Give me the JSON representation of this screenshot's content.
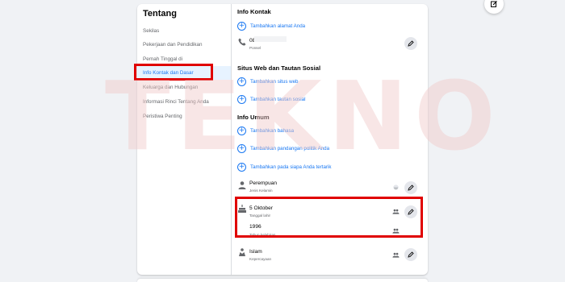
{
  "watermark": "TEKNO",
  "sidebar": {
    "title": "Tentang",
    "items": [
      {
        "label": "Sekilas"
      },
      {
        "label": "Pekerjaan dan Pendidikan"
      },
      {
        "label": "Pernah Tinggal di"
      },
      {
        "label": "Info Kontak dan Dasar",
        "active": true
      },
      {
        "label": "Keluarga dan Hubungan"
      },
      {
        "label": "Informasi Rinci Tentang Anda"
      },
      {
        "label": "Peristiwa Penting"
      }
    ]
  },
  "contact": {
    "title": "Info Kontak",
    "add_address": "Tambahkan alamat Anda",
    "phone_value": "081",
    "phone_sub": "Ponsel"
  },
  "web": {
    "title": "Situs Web dan Tautan Sosial",
    "add_site": "Tambahkan situs web",
    "add_link": "Tambahkan tautan sosial"
  },
  "general": {
    "title": "Info Umum",
    "add_language": "Tambahkan bahasa",
    "add_politics": "Tambahkan pandangan politik Anda",
    "add_interest": "Tambahkan pada siapa Anda tertarik",
    "gender_value": "Perempuan",
    "gender_sub": "Jenis Kelamin",
    "birthdate_value": "5 Oktober",
    "birthdate_sub": "Tanggal lahir",
    "birthyear_value": "1996",
    "birthyear_sub": "Tahun kelahiran",
    "religion_value": "Islam",
    "religion_sub": "Kepercayaan"
  },
  "icons": {
    "plus": "plus-circle-icon",
    "edit": "pencil-icon",
    "phone": "phone-icon",
    "person": "person-icon",
    "cake": "cake-icon",
    "religion": "hands-icon",
    "audience_friends": "friends-icon",
    "audience_public": "globe-icon"
  },
  "colors": {
    "accent": "#1877f2",
    "highlight": "#e00000",
    "active_bg": "#e7f3ff"
  }
}
